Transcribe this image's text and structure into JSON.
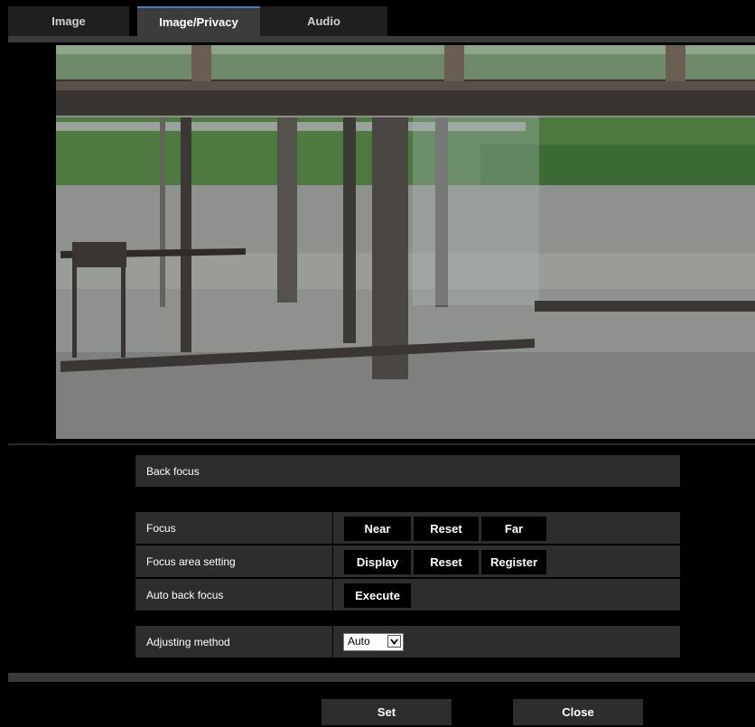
{
  "tabs": [
    {
      "label": "Image",
      "active": false
    },
    {
      "label": "Image/Privacy",
      "active": true
    },
    {
      "label": "Audio",
      "active": false
    }
  ],
  "camera_view": {
    "description": "live-camera-preview"
  },
  "back_focus": {
    "header": "Back focus",
    "focus": {
      "label": "Focus",
      "near": "Near",
      "reset": "Reset",
      "far": "Far"
    },
    "focus_area": {
      "label": "Focus area setting",
      "display": "Display",
      "reset": "Reset",
      "register": "Register"
    },
    "auto_back_focus": {
      "label": "Auto back focus",
      "execute": "Execute"
    },
    "adjusting_method": {
      "label": "Adjusting method",
      "value": "Auto"
    }
  },
  "footer": {
    "set": "Set",
    "close": "Close"
  },
  "colors": {
    "accent": "#3f7fd0",
    "panel": "#2d2d2d",
    "button": "#000000"
  }
}
